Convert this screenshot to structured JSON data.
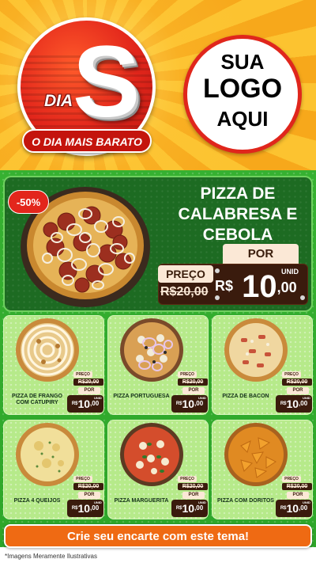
{
  "header": {
    "badge_dia": "DIA",
    "badge_letter": "S",
    "slogan": "O DIA MAIS BARATO",
    "logo_line1": "SUA",
    "logo_line2": "LOGO",
    "logo_line3": "AQUI"
  },
  "featured": {
    "discount": "-50%",
    "title_line1": "PIZZA DE",
    "title_line2": "CALABRESA E",
    "title_line3": "CEBOLA",
    "preco_label": "PREÇO",
    "old_price": "R$20,00",
    "por_label": "POR",
    "currency": "R$",
    "price_int": "10",
    "price_cents": ",00",
    "unit": "UNID"
  },
  "products": [
    {
      "name": "PIZZA DE FRANGO COM CATUPIRY",
      "preco_label": "PREÇO",
      "old_price": "R$20,00",
      "por_label": "POR",
      "currency": "R$",
      "price_int": "10",
      "price_cents": ",00",
      "unit": "UNID"
    },
    {
      "name": "PIZZA PORTUGUESA",
      "preco_label": "PREÇO",
      "old_price": "R$20,00",
      "por_label": "POR",
      "currency": "R$",
      "price_int": "10",
      "price_cents": ",00",
      "unit": "UNID"
    },
    {
      "name": "PIZZA DE BACON",
      "preco_label": "PREÇO",
      "old_price": "R$20,00",
      "por_label": "POR",
      "currency": "R$",
      "price_int": "10",
      "price_cents": ",00",
      "unit": "UNID"
    },
    {
      "name": "PIZZA 4 QUEIJOS",
      "preco_label": "PREÇO",
      "old_price": "R$20,00",
      "por_label": "POR",
      "currency": "R$",
      "price_int": "10",
      "price_cents": ",00",
      "unit": "UNID"
    },
    {
      "name": "PIZZA MARGUERITA",
      "preco_label": "PREÇO",
      "old_price": "R$20,00",
      "por_label": "POR",
      "currency": "R$",
      "price_int": "10",
      "price_cents": ",00",
      "unit": "UNID"
    },
    {
      "name": "PIZZA COM DORITOS",
      "preco_label": "PREÇO",
      "old_price": "R$20,00",
      "por_label": "POR",
      "currency": "R$",
      "price_int": "10",
      "price_cents": ",00",
      "unit": "UNID"
    }
  ],
  "cta": {
    "label": "Crie seu encarte com este tema!"
  },
  "footer": {
    "note": "*Imagens Meramente Ilustrativas"
  },
  "colors": {
    "header_orange": "#f7a81b",
    "badge_red": "#e2261b",
    "green_bg": "#36b131",
    "featured_green": "#1d6b22",
    "card_green": "#b6ea8a",
    "price_brown": "#3a1b0d",
    "price_cream": "#fbe8d6",
    "cta_orange": "#ef6a13"
  }
}
